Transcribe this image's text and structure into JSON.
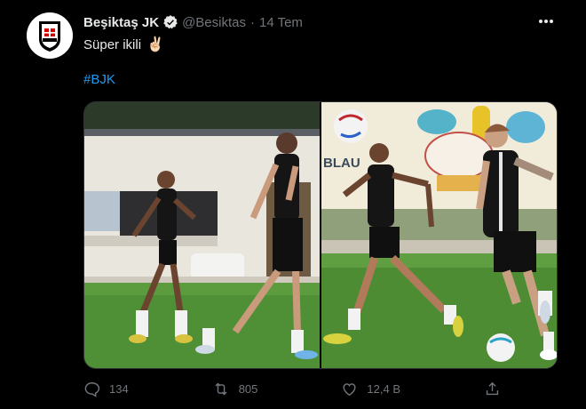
{
  "tweet": {
    "display_name": "Beşiktaş JK",
    "handle": "@Besiktas",
    "separator": "·",
    "time": "14 Tem",
    "text": "Süper ikili",
    "emoji": "✌🏻",
    "hashtag": "#BJK",
    "avatar_logo_text": "BJK 1903"
  },
  "photos": {
    "left_banner": "",
    "right_banner": "BLAU"
  },
  "actions": {
    "replies": "134",
    "retweets": "805",
    "likes": "12,4 B"
  },
  "icons": {
    "verified": "verified-badge-icon",
    "more": "more-icon",
    "reply": "reply-icon",
    "retweet": "retweet-icon",
    "like": "like-icon",
    "share": "share-icon"
  },
  "colors": {
    "background": "#000000",
    "text": "#e7e9ea",
    "muted": "#71767b",
    "link": "#1d9bf0",
    "grass": "#4f8f35"
  }
}
